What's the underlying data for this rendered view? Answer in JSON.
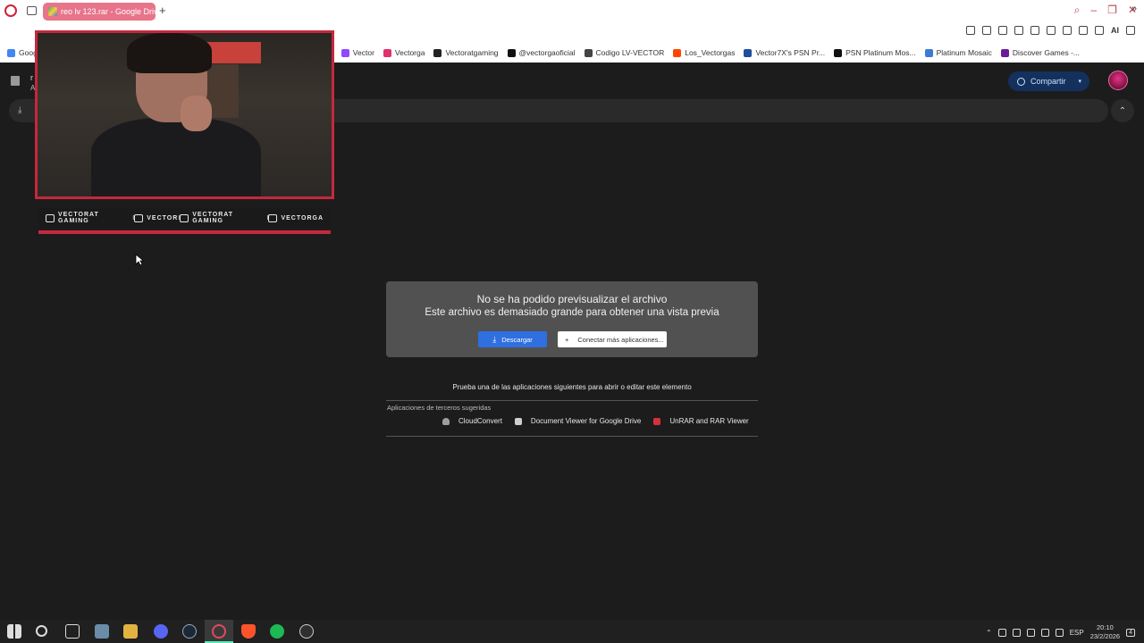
{
  "browser": {
    "tab_title": "reo lv 123.rar - Google Drive",
    "new_tab": "+",
    "ai_label": "AI",
    "bookmarks_more": "»",
    "bookmarks": [
      {
        "label": "Goog",
        "color": "#4285f4"
      },
      {
        "label": "Vector",
        "color": "#9146ff"
      },
      {
        "label": "Vectorga",
        "color": "#e1306c"
      },
      {
        "label": "Vectoratgaming",
        "color": "#222222"
      },
      {
        "label": "@vectorgaoficial",
        "color": "#111111"
      },
      {
        "label": "Codigo LV-VECTOR",
        "color": "#444444"
      },
      {
        "label": "Los_Vectorgas",
        "color": "#ff4500"
      },
      {
        "label": "Vector7X's PSN Pr...",
        "color": "#1f4e9c"
      },
      {
        "label": "PSN Platinum Mos...",
        "color": "#111111"
      },
      {
        "label": "Platinum Mosaic",
        "color": "#3a7bd5"
      },
      {
        "label": "Discover Games -...",
        "color": "#6a1b9a"
      }
    ]
  },
  "drive": {
    "file_name": "r",
    "file_sub": "A",
    "share_label": "Compartir",
    "share_caret": "▾",
    "collapse_icon": "⌃",
    "download_icon": "⤓"
  },
  "overlay": {
    "socials": [
      {
        "label": "VECTORAT GAMING",
        "icon": "youtube-icon"
      },
      {
        "label": "VECTOR",
        "icon": "twitch-icon"
      },
      {
        "label": "VECTORAT GAMING",
        "icon": "twitter-icon"
      },
      {
        "label": "VECTORGA",
        "icon": "instagram-icon"
      }
    ],
    "separator": "I",
    "accent": "#c5283d"
  },
  "preview": {
    "title": "No se ha podido previsualizar el archivo",
    "subtitle": "Este archivo es demasiado grande para obtener una vista previa",
    "download_label": "Descargar",
    "connect_label": "Conectar más aplicaciones...",
    "connect_plus": "+",
    "apps_hint": "Prueba una de las aplicaciones siguientes para abrir o editar este elemento",
    "apps_section_label": "Aplicaciones de terceros sugeridas",
    "apps": [
      {
        "label": "CloudConvert",
        "color": "#9e9e9e"
      },
      {
        "label": "Document Viewer for Google Drive",
        "color": "#cfcfcf"
      },
      {
        "label": "UnRAR and RAR Viewer",
        "color": "#d6303d"
      }
    ]
  },
  "taskbar": {
    "lang": "ESP",
    "time": "20:10",
    "date": "23/2/2026",
    "notif_count": "4"
  }
}
